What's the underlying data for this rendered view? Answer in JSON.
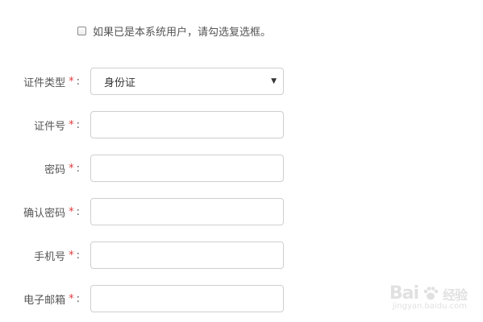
{
  "checkbox": {
    "label": "如果已是本系统用户，请勾选复选框。",
    "checked": false
  },
  "form": {
    "fields": [
      {
        "label": "证件类型",
        "required_mark": "*",
        "colon": ":",
        "type": "select",
        "value": "身份证"
      },
      {
        "label": "证件号",
        "required_mark": "*",
        "colon": ":",
        "type": "text",
        "value": ""
      },
      {
        "label": "密码",
        "required_mark": "*",
        "colon": ":",
        "type": "password",
        "value": ""
      },
      {
        "label": "确认密码",
        "required_mark": "*",
        "colon": ":",
        "type": "password",
        "value": ""
      },
      {
        "label": "手机号",
        "required_mark": "*",
        "colon": ":",
        "type": "text",
        "value": ""
      },
      {
        "label": "电子邮箱",
        "required_mark": "*",
        "colon": ":",
        "type": "text",
        "value": ""
      }
    ]
  },
  "watermark": {
    "brand": "Bai",
    "brand_suffix": "经验",
    "url": "jingyan.baidu.com"
  },
  "colors": {
    "required": "#e4393c",
    "border": "#cfcfcf",
    "text": "#555555"
  }
}
